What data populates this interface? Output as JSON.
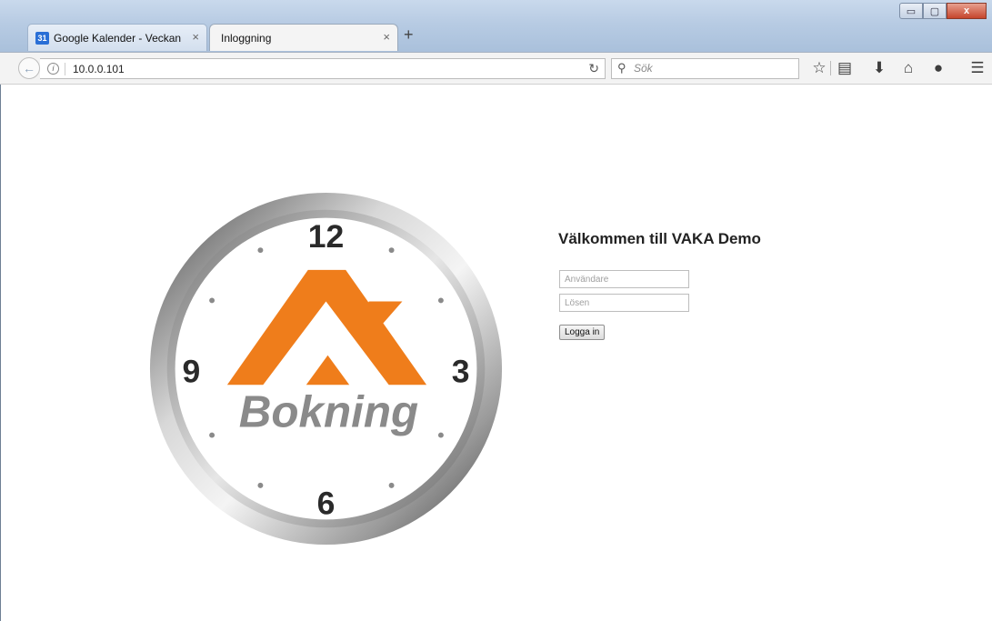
{
  "browser": {
    "tabs": [
      {
        "label": "Google Kalender - Veckan ...",
        "favicon_text": "31"
      },
      {
        "label": "Inloggning"
      }
    ],
    "tab_close_symbol": "×",
    "new_tab_symbol": "+",
    "url": "10.0.0.101",
    "search_placeholder": "Sök",
    "window_controls": {
      "minimize": "▭",
      "maximize": "▢",
      "close": "x"
    },
    "toolbar_icons": [
      "star-icon",
      "reading-list-icon",
      "download-icon",
      "home-icon",
      "chat-icon",
      "menu-icon"
    ]
  },
  "logo": {
    "numbers": {
      "twelve": "12",
      "three": "3",
      "six": "6",
      "nine": "9"
    },
    "brand": "Bokning",
    "colors": {
      "orange": "#ef7d1b",
      "gray": "#8a8a8a",
      "ring": "#5a5a5a"
    }
  },
  "login": {
    "title": "Välkommen till VAKA Demo",
    "username_placeholder": "Användare",
    "password_placeholder": "Lösen",
    "button_label": "Logga in"
  }
}
